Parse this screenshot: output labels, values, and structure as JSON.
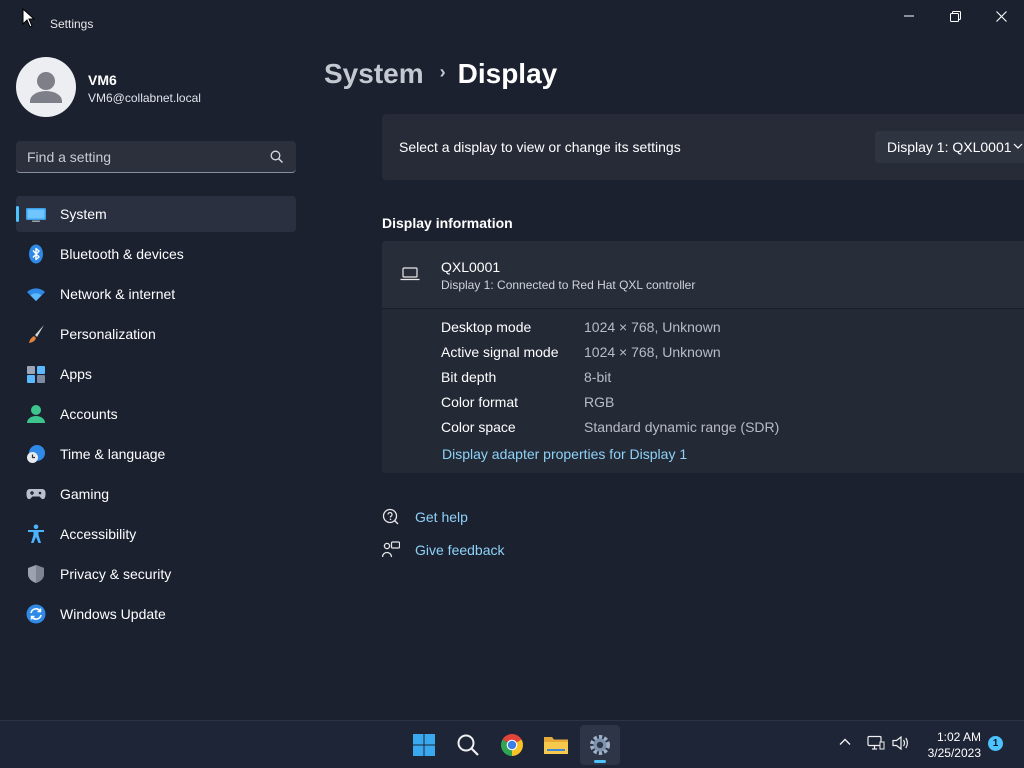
{
  "window": {
    "title": "Settings"
  },
  "user": {
    "name": "VM6",
    "email": "VM6@collabnet.local"
  },
  "search": {
    "placeholder": "Find a setting",
    "icon": "search-icon"
  },
  "nav": {
    "items": [
      {
        "label": "System",
        "icon": "system-monitor-icon",
        "active": true
      },
      {
        "label": "Bluetooth & devices",
        "icon": "bluetooth-icon"
      },
      {
        "label": "Network & internet",
        "icon": "wifi-icon"
      },
      {
        "label": "Personalization",
        "icon": "paintbrush-icon"
      },
      {
        "label": "Apps",
        "icon": "apps-icon"
      },
      {
        "label": "Accounts",
        "icon": "accounts-icon"
      },
      {
        "label": "Time & language",
        "icon": "globe-clock-icon"
      },
      {
        "label": "Gaming",
        "icon": "gamepad-icon"
      },
      {
        "label": "Accessibility",
        "icon": "accessibility-icon"
      },
      {
        "label": "Privacy & security",
        "icon": "shield-icon"
      },
      {
        "label": "Windows Update",
        "icon": "update-icon"
      }
    ]
  },
  "breadcrumb": {
    "parent": "System",
    "separator": "›",
    "current": "Display"
  },
  "select_display": {
    "label": "Select a display to view or change its settings",
    "selected": "Display 1: QXL0001"
  },
  "display_info": {
    "section_title": "Display information",
    "device_name": "QXL0001",
    "device_subtitle": "Display 1: Connected to Red Hat QXL controller",
    "rows": [
      {
        "key": "Desktop mode",
        "value": "1024 × 768, Unknown"
      },
      {
        "key": "Active signal mode",
        "value": "1024 × 768, Unknown"
      },
      {
        "key": "Bit depth",
        "value": "8-bit"
      },
      {
        "key": "Color format",
        "value": "RGB"
      },
      {
        "key": "Color space",
        "value": "Standard dynamic range (SDR)"
      }
    ],
    "adapter_link": "Display adapter properties for Display 1"
  },
  "help": {
    "get_help": "Get help",
    "give_feedback": "Give feedback"
  },
  "taskbar": {
    "apps": [
      "start-icon",
      "search-icon",
      "chrome-icon",
      "file-explorer-icon",
      "settings-icon"
    ],
    "time": "1:02 AM",
    "date": "3/25/2023",
    "notification_count": "1"
  },
  "colors": {
    "accent": "#4cc2ff",
    "link": "#8ed2f7",
    "background": "#1c2130",
    "card": "#262b37"
  }
}
